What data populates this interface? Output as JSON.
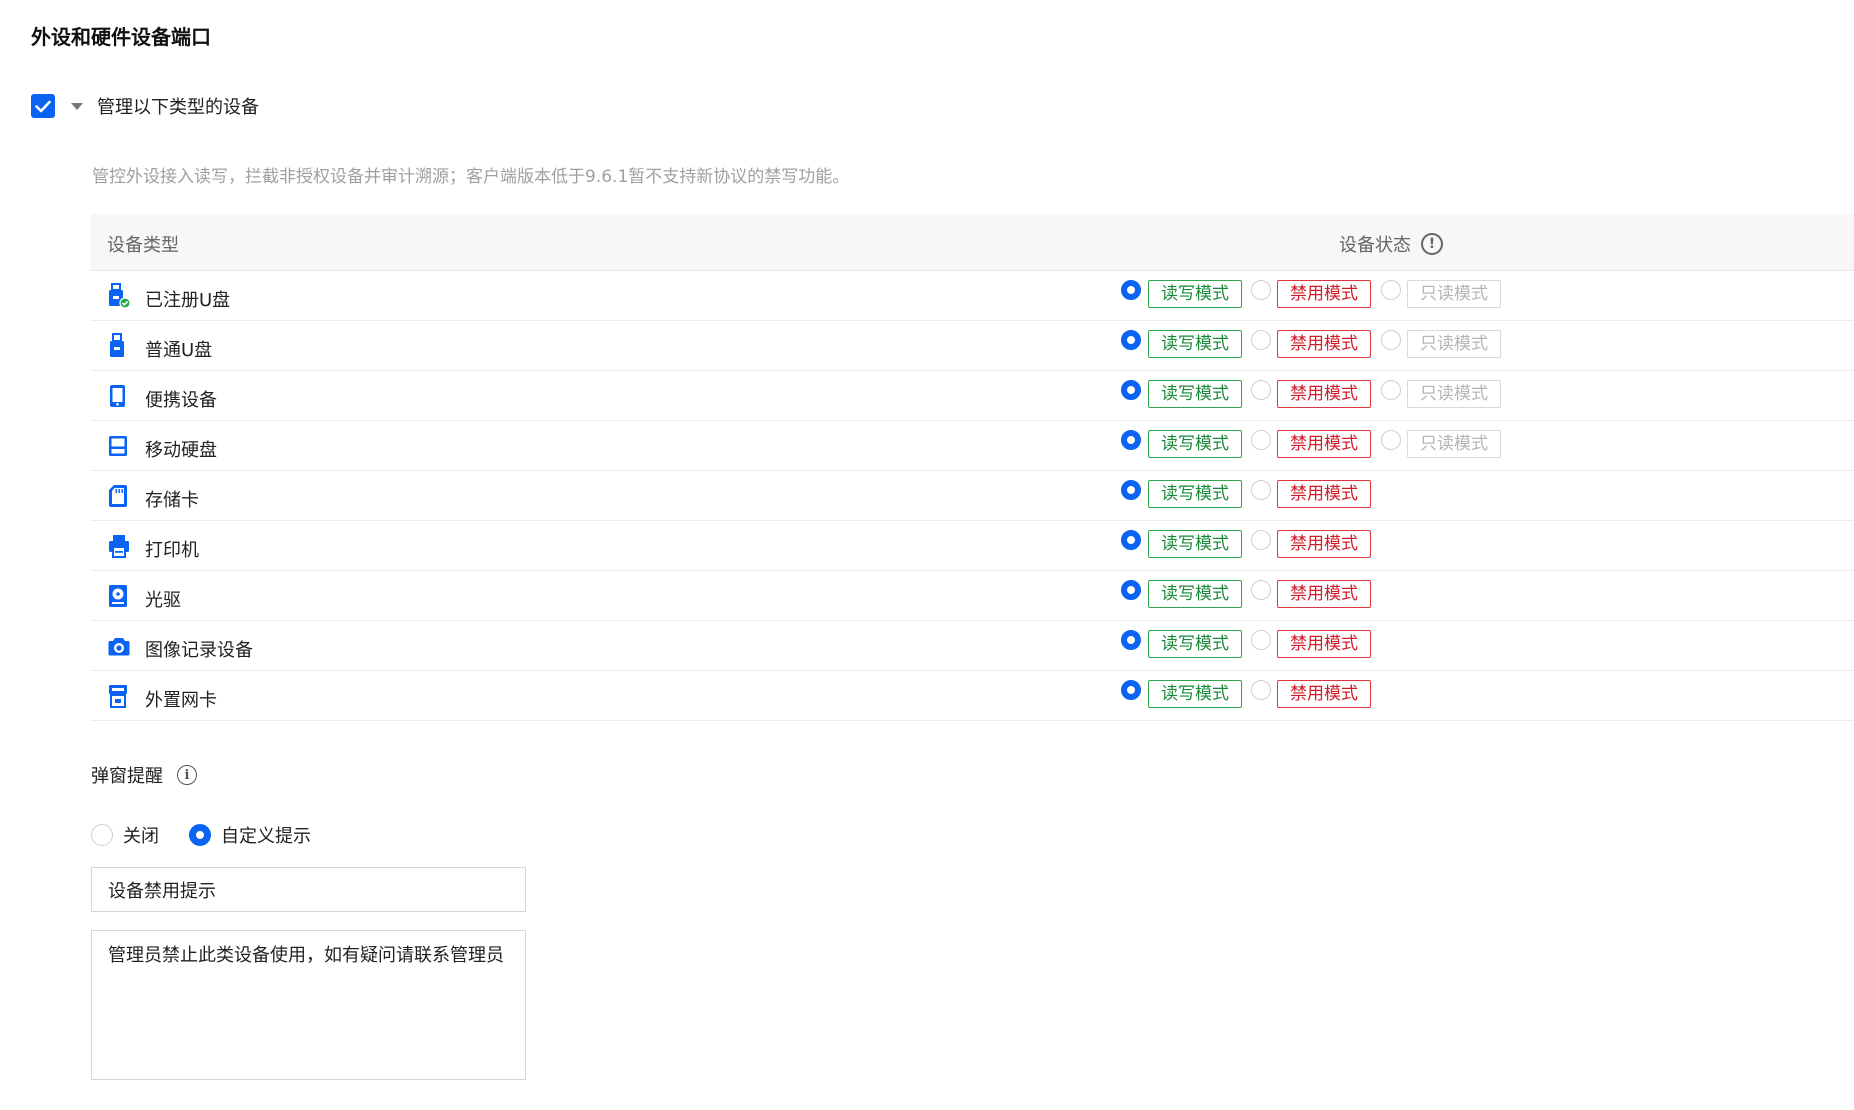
{
  "section_title": "外设和硬件设备端口",
  "master": {
    "checked": true,
    "label": "管理以下类型的设备"
  },
  "description": "管控外设接入读写，拦截非授权设备并审计溯源；客户端版本低于9.6.1暂不支持新协议的禁写功能。",
  "table": {
    "col_type": "设备类型",
    "col_status": "设备状态",
    "modes": {
      "rw": "读写模式",
      "ban": "禁用模式",
      "ro": "只读模式"
    },
    "rows": [
      {
        "name": "已注册U盘",
        "icon": "registered-usb-icon",
        "selected": "rw",
        "has_ro": true
      },
      {
        "name": "普通U盘",
        "icon": "usb-icon",
        "selected": "rw",
        "has_ro": true
      },
      {
        "name": "便携设备",
        "icon": "portable-device-icon",
        "selected": "rw",
        "has_ro": true
      },
      {
        "name": "移动硬盘",
        "icon": "external-hdd-icon",
        "selected": "rw",
        "has_ro": true
      },
      {
        "name": "存储卡",
        "icon": "sd-card-icon",
        "selected": "rw",
        "has_ro": false
      },
      {
        "name": "打印机",
        "icon": "printer-icon",
        "selected": "rw",
        "has_ro": false
      },
      {
        "name": "光驱",
        "icon": "optical-drive-icon",
        "selected": "rw",
        "has_ro": false
      },
      {
        "name": "图像记录设备",
        "icon": "camera-icon",
        "selected": "rw",
        "has_ro": false
      },
      {
        "name": "外置网卡",
        "icon": "network-card-icon",
        "selected": "rw",
        "has_ro": false
      }
    ]
  },
  "popup": {
    "label": "弹窗提醒",
    "options": [
      {
        "label": "关闭",
        "selected": false
      },
      {
        "label": "自定义提示",
        "selected": true
      }
    ],
    "title_value": "设备禁用提示",
    "message_value": "管理员禁止此类设备使用，如有疑问请联系管理员"
  },
  "colors": {
    "accent": "#0a63f2",
    "rw": "#2ea44f",
    "ban": "#d9363e",
    "ro": "#d9d9d9"
  }
}
